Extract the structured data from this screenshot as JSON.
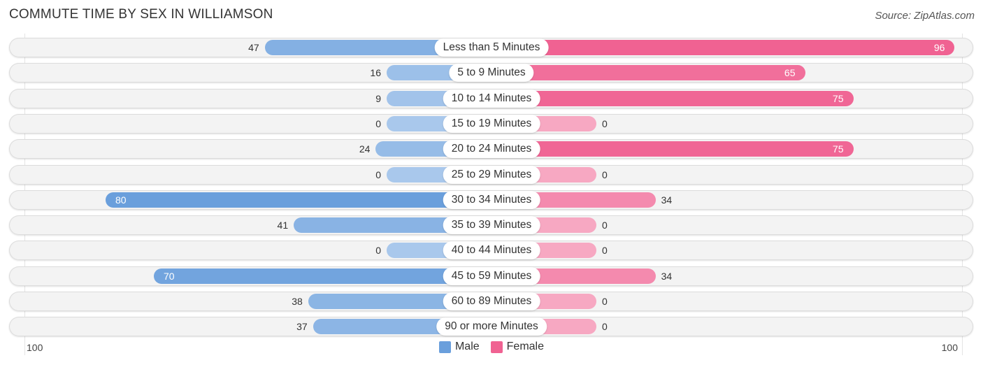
{
  "chart_data": {
    "type": "bar",
    "orientation": "horizontal-diverging",
    "title": "COMMUTE TIME BY SEX IN WILLIAMSON",
    "source": "Source: ZipAtlas.com",
    "categories": [
      "Less than 5 Minutes",
      "5 to 9 Minutes",
      "10 to 14 Minutes",
      "15 to 19 Minutes",
      "20 to 24 Minutes",
      "25 to 29 Minutes",
      "30 to 34 Minutes",
      "35 to 39 Minutes",
      "40 to 44 Minutes",
      "45 to 59 Minutes",
      "60 to 89 Minutes",
      "90 or more Minutes"
    ],
    "series": [
      {
        "name": "Male",
        "color": "#6a9fdc",
        "light_color": "#a9c8ec",
        "values": [
          47,
          16,
          9,
          0,
          24,
          0,
          80,
          41,
          0,
          70,
          38,
          37
        ]
      },
      {
        "name": "Female",
        "color": "#f06292",
        "light_color": "#f7a8c2",
        "values": [
          96,
          65,
          75,
          0,
          75,
          0,
          34,
          0,
          0,
          34,
          0,
          0
        ]
      }
    ],
    "axis": {
      "left_label": "100",
      "right_label": "100",
      "range": [
        -100,
        100
      ]
    },
    "legend": {
      "placement": "bottom-center",
      "items": [
        "Male",
        "Female"
      ]
    }
  }
}
